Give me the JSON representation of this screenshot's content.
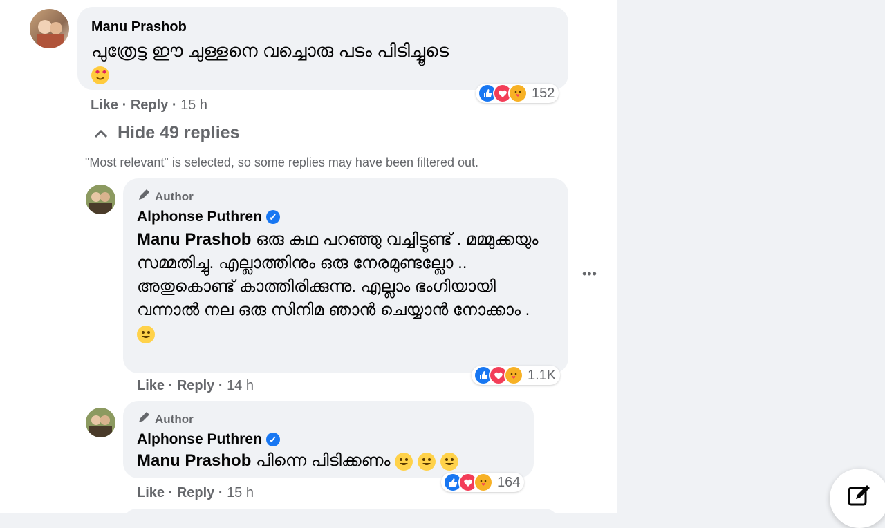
{
  "comments": [
    {
      "author": "Manu Prashob",
      "text": "പുത്രേട്ട ഈ ചുള്ളനെ വച്ചൊരു പടം പിടിച്ചൂടെ",
      "reaction_count": "152",
      "like": "Like",
      "reply": "Reply",
      "time": "15 h"
    }
  ],
  "thread": {
    "hide_replies": "Hide 49 replies",
    "filter_note": "\"Most relevant\" is selected, so some replies may have been filtered out."
  },
  "replies": [
    {
      "author_tag": "Author",
      "author": "Alphonse Puthren",
      "mention": "Manu Prashob",
      "text": "ഒരു കഥ പറഞ്ഞു വച്ചിട്ടുണ്ട് . മമ്മുക്കയും സമ്മതിച്ചു. എല്ലാത്തിനും ഒരു നേരമുണ്ടല്ലോ .. അതുകൊണ്ട് കാത്തിരിക്കുന്നു. എല്ലാം ഭംഗിയായി വന്നാൽ നല ഒരു സിനിമ ഞാൻ ചെയ്യാൻ നോക്കാം .",
      "reaction_count": "1.1K",
      "like": "Like",
      "reply": "Reply",
      "time": "14 h"
    },
    {
      "author_tag": "Author",
      "author": "Alphonse Puthren",
      "mention": "Manu Prashob",
      "text": "പിന്നെ പിടിക്കണം",
      "reaction_count": "164",
      "like": "Like",
      "reply": "Reply",
      "time": "15 h"
    }
  ],
  "more_menu": "•••",
  "colors": {
    "like_blue": "#1877f2",
    "love_red": "#f33e58",
    "care_yellow": "#f7b125",
    "muted": "#65676b"
  },
  "icons": [
    "chevron-up-icon",
    "pencil-icon",
    "verified-badge-icon",
    "like-reaction-icon",
    "love-reaction-icon",
    "care-reaction-icon",
    "more-options-icon",
    "compose-icon"
  ]
}
